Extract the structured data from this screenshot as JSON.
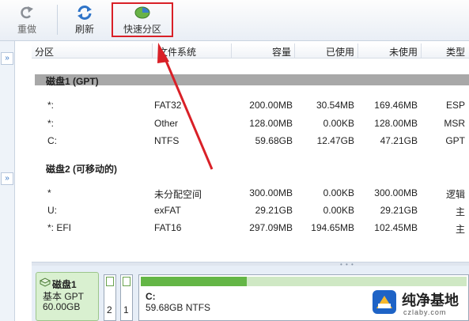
{
  "toolbar": {
    "redo_label": "重做",
    "refresh_label": "刷新",
    "quick_partition_label": "快速分区"
  },
  "columns": [
    "分区",
    "文件系统",
    "容量",
    "已使用",
    "未使用",
    "类型"
  ],
  "disks": [
    {
      "title": "磁盘1 (GPT)",
      "rows": [
        {
          "partition": "*:",
          "fs": "FAT32",
          "capacity": "200.00MB",
          "used": "30.54MB",
          "free": "169.46MB",
          "type": "ESP"
        },
        {
          "partition": "*:",
          "fs": "Other",
          "capacity": "128.00MB",
          "used": "0.00KB",
          "free": "128.00MB",
          "type": "MSR"
        },
        {
          "partition": "C:",
          "fs": "NTFS",
          "capacity": "59.68GB",
          "used": "12.47GB",
          "free": "47.21GB",
          "type": "GPT"
        }
      ]
    },
    {
      "title": "磁盘2 (可移动的)",
      "rows": [
        {
          "partition": "*",
          "fs": "未分配空间",
          "capacity": "300.00MB",
          "used": "0.00KB",
          "free": "300.00MB",
          "type": "逻辑"
        },
        {
          "partition": "U:",
          "fs": "exFAT",
          "capacity": "29.21GB",
          "used": "0.00KB",
          "free": "29.21GB",
          "type": "主"
        },
        {
          "partition": "*: EFI",
          "fs": "FAT16",
          "capacity": "297.09MB",
          "used": "194.65MB",
          "free": "102.45MB",
          "type": "主"
        }
      ]
    }
  ],
  "diskmap": {
    "disk_name": "磁盘1",
    "disk_kind": "基本 GPT",
    "disk_size": "60.00GB",
    "mini_label_1": "2",
    "mini_label_2": "1",
    "part_name": "C:",
    "part_detail": "59.68GB NTFS",
    "part_used_fraction": 0.21
  },
  "watermark": {
    "title": "纯净基地",
    "url": "czlaby.com"
  },
  "colors": {
    "highlight": "#d92027",
    "arrow": "#d92027",
    "used_fill": "#64b646",
    "disk_header_bar": "#a8a8a8"
  },
  "icons": [
    "redo-icon",
    "refresh-icon",
    "quick-partition-icon",
    "collapse-icon",
    "disk-icon",
    "logo-icon"
  ]
}
